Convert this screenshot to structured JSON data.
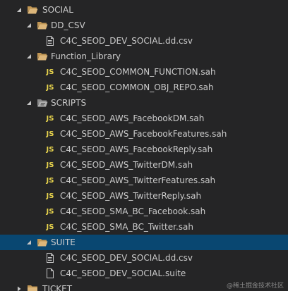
{
  "explorer": {
    "items": [
      {
        "label": "SOCIAL",
        "type": "folder",
        "expanded": true,
        "icon": "folder-open-icon"
      },
      {
        "label": "DD_CSV",
        "type": "folder",
        "expanded": true,
        "icon": "folder-open-icon"
      },
      {
        "label": "C4C_SEOD_DEV_SOCIAL.dd.csv",
        "type": "file",
        "icon": "csv-file-icon"
      },
      {
        "label": "Function_Library",
        "type": "folder",
        "expanded": true,
        "icon": "folder-open-icon"
      },
      {
        "label": "C4C_SEOD_COMMON_FUNCTION.sah",
        "type": "file",
        "icon": "js-file-icon",
        "badge": "JS"
      },
      {
        "label": "C4C_SEOD_COMMON_OBJ_REPO.sah",
        "type": "file",
        "icon": "js-file-icon",
        "badge": "JS"
      },
      {
        "label": "SCRIPTS",
        "type": "folder",
        "expanded": true,
        "icon": "scripts-folder-icon"
      },
      {
        "label": "C4C_SEOD_AWS_FacebookDM.sah",
        "type": "file",
        "icon": "js-file-icon",
        "badge": "JS"
      },
      {
        "label": "C4C_SEOD_AWS_FacebookFeatures.sah",
        "type": "file",
        "icon": "js-file-icon",
        "badge": "JS"
      },
      {
        "label": "C4C_SEOD_AWS_FacebookReply.sah",
        "type": "file",
        "icon": "js-file-icon",
        "badge": "JS"
      },
      {
        "label": "C4C_SEOD_AWS_TwitterDM.sah",
        "type": "file",
        "icon": "js-file-icon",
        "badge": "JS"
      },
      {
        "label": "C4C_SEOD_AWS_TwitterFeatures.sah",
        "type": "file",
        "icon": "js-file-icon",
        "badge": "JS"
      },
      {
        "label": "C4C_SEOD_AWS_TwitterReply.sah",
        "type": "file",
        "icon": "js-file-icon",
        "badge": "JS"
      },
      {
        "label": "C4C_SEOD_SMA_BC_Facebook.sah",
        "type": "file",
        "icon": "js-file-icon",
        "badge": "JS"
      },
      {
        "label": "C4C_SEOD_SMA_BC_Twitter.sah",
        "type": "file",
        "icon": "js-file-icon",
        "badge": "JS"
      },
      {
        "label": "SUITE",
        "type": "folder",
        "expanded": true,
        "icon": "folder-open-icon",
        "selected": true
      },
      {
        "label": "C4C_SEOD_DEV_SOCIAL.dd.csv",
        "type": "file",
        "icon": "csv-file-icon"
      },
      {
        "label": "C4C_SEOD_DEV_SOCIAL.suite",
        "type": "file",
        "icon": "generic-file-icon"
      },
      {
        "label": "TICKET",
        "type": "folder",
        "expanded": false,
        "icon": "folder-closed-icon"
      }
    ]
  },
  "watermark": "@稀土掘金技术社区",
  "colors": {
    "background": "#252526",
    "selected": "#094771",
    "text": "#cccccc",
    "js_badge": "#e8d44d",
    "folder": "#c09553"
  }
}
